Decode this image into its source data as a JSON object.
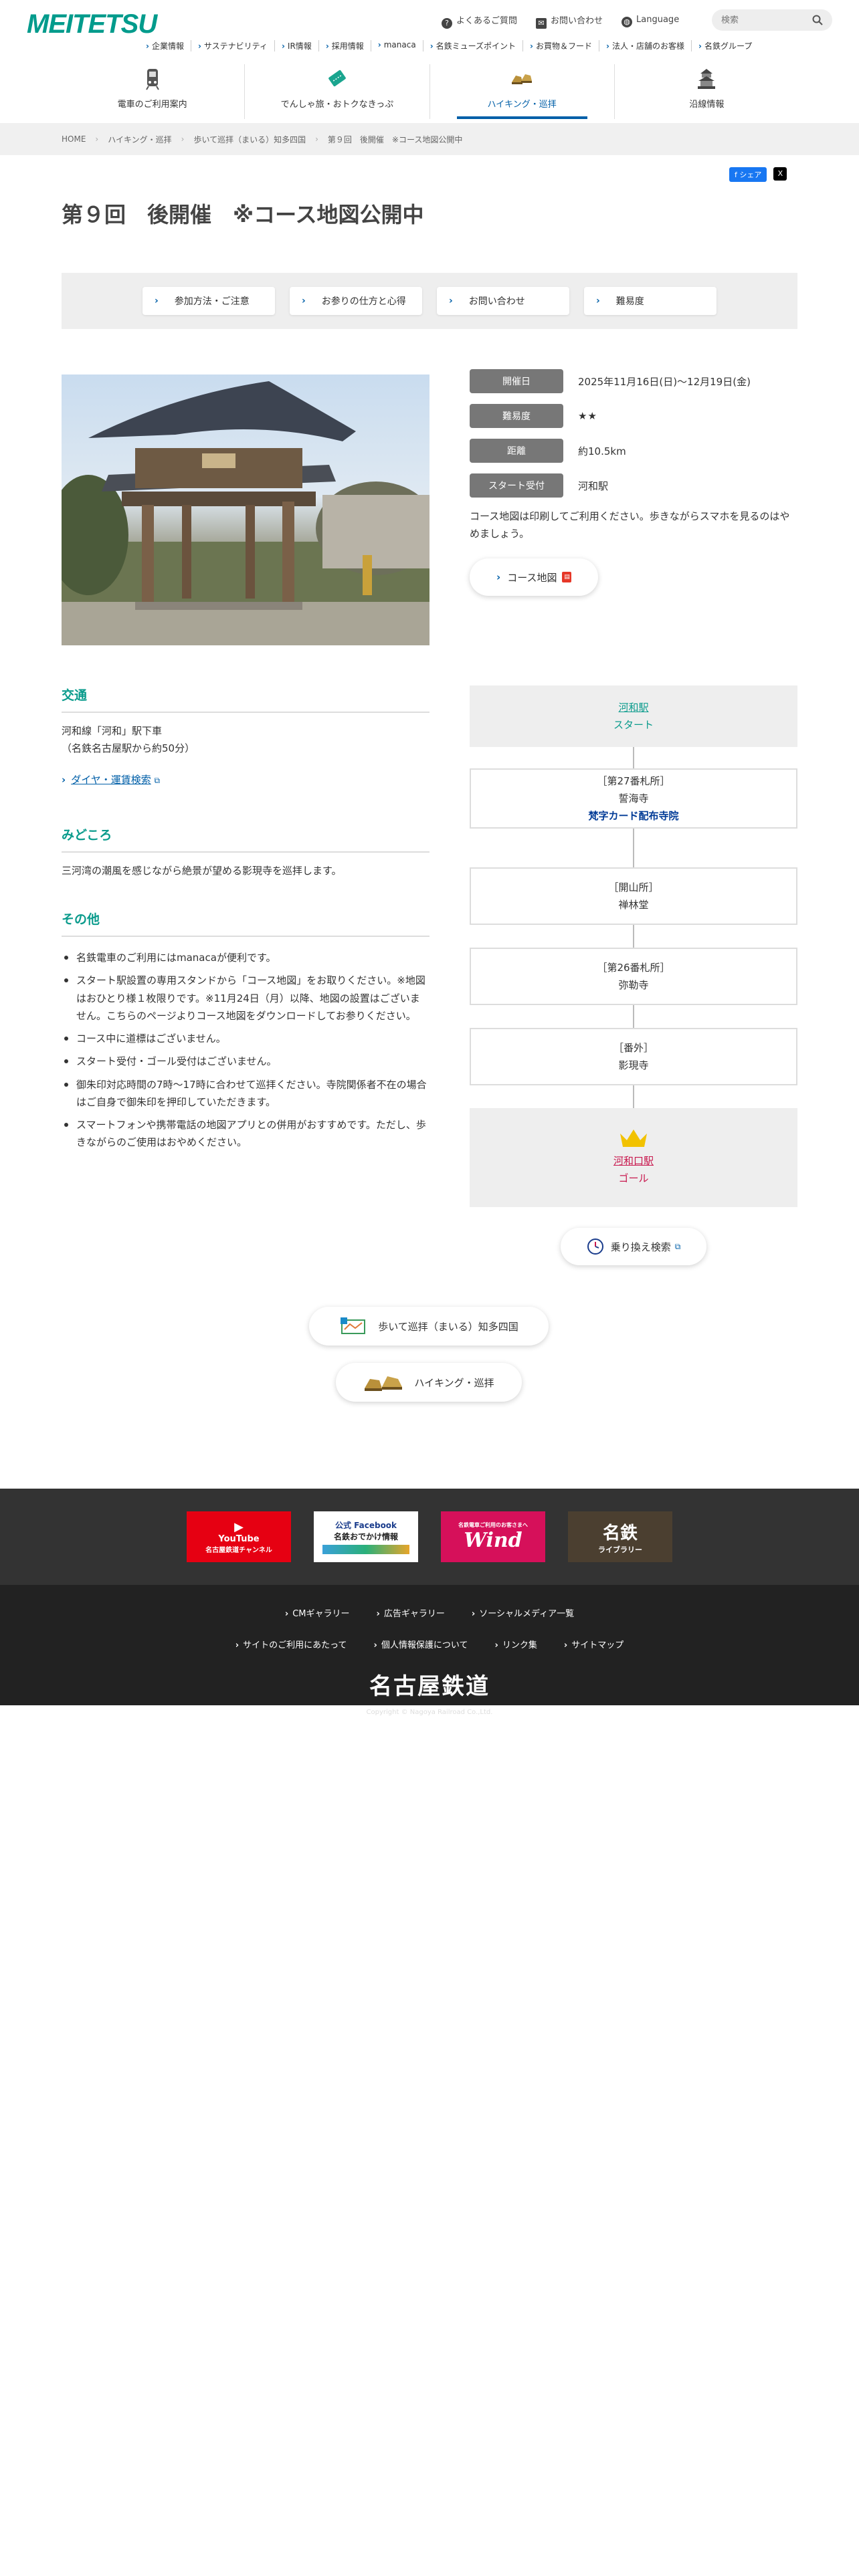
{
  "header": {
    "logo_text": "MEITETSU",
    "util_links": [
      "よくあるご質問",
      "お問い合わせ",
      "Language"
    ],
    "search_placeholder": "検索",
    "sub_links": [
      "企業情報",
      "サステナビリティ",
      "IR情報",
      "採用情報",
      "manaca",
      "名鉄ミューズポイント",
      "お買物＆フード",
      "法人・店舗のお客様",
      "名鉄グループ"
    ],
    "gnav": [
      {
        "label": "電車のご利用案内",
        "icon": "train-icon"
      },
      {
        "label": "でんしゃ旅・おトクなきっぷ",
        "icon": "ticket-icon"
      },
      {
        "label": "ハイキング・巡拝",
        "icon": "hiking-shoes-icon"
      },
      {
        "label": "沿線情報",
        "icon": "castle-icon"
      }
    ]
  },
  "breadcrumb": [
    "HOME",
    "ハイキング・巡拝",
    "歩いて巡拝（まいる）知多四国",
    "第９回　後開催　※コース地図公開中"
  ],
  "share": {
    "facebook": "シェア",
    "x": "X"
  },
  "title": "第９回　後開催　※コース地図公開中",
  "anchors": [
    "参加方法・ご注意",
    "お参りの仕方と心得",
    "お問い合わせ",
    "難易度"
  ],
  "info": {
    "date_label": "開催日",
    "date_value": "2025年11月16日(日)〜12月19日(金)",
    "difficulty_label": "難易度",
    "difficulty_stars": "★★",
    "distance_label": "距離",
    "distance_value": "約10.5km",
    "start_label": "スタート受付",
    "start_value": "河和駅",
    "note": "コース地図は印刷してご利用ください。歩きながらスマホを見るのはやめましょう。",
    "map_button": "コース地図"
  },
  "access": {
    "heading": "交通",
    "text1": "河和線「河和」駅下車",
    "text2": "（名鉄名古屋駅から約50分）",
    "link": "ダイヤ・運賃検索"
  },
  "highlight": {
    "heading": "みどころ",
    "text": "三河湾の潮風を感じながら絶景が望める影現寺を巡拝します。"
  },
  "other": {
    "heading": "その他",
    "items": [
      "名鉄電車のご利用にはmanacaが便利です。",
      "スタート駅設置の専用スタンドから「コース地図」をお取りください。※地図はおひとり様１枚限りです。※11月24日（月）以降、地図の設置はございません。こちらのページよりコース地図をダウンロードしてお参りください。",
      "コース中に道標はございません。",
      "スタート受付・ゴール受付はございません。",
      "御朱印対応時間の7時〜17時に合わせて巡拝ください。寺院関係者不在の場合はご自身で御朱印を押印していただきます。",
      "スマートフォンや携帯電話の地図アプリとの併用がおすすめです。ただし、歩きながらのご使用はおやめください。"
    ]
  },
  "route": {
    "start_station": "河和駅",
    "start_label": "スタート",
    "stops": [
      {
        "label": "［第27番札所］",
        "name": "誓海寺",
        "extra": "梵字カード配布寺院"
      },
      {
        "label": "［開山所］",
        "name": "禅林堂",
        "extra": ""
      },
      {
        "label": "［第26番札所］",
        "name": "弥勒寺",
        "extra": ""
      },
      {
        "label": "［番外］",
        "name": "影現寺",
        "extra": ""
      }
    ],
    "goal_station": "河和口駅",
    "goal_label": "ゴール",
    "transfer_button": "乗り換え検索"
  },
  "bottom_buttons": [
    "歩いて巡拝（まいる）知多四国",
    "ハイキング・巡拝"
  ],
  "footer": {
    "banners": [
      {
        "title": "YouTube",
        "sub": "名古屋鉄道チャンネル",
        "color": "#e60012"
      },
      {
        "title": "公式 Facebook",
        "sub": "名鉄おでかけ情報",
        "color": "#ffffff"
      },
      {
        "title": "Wind",
        "sub": "名鉄電車ご利用のお客さまへ",
        "color": "#d6105a"
      },
      {
        "title": "名鉄",
        "sub": "ライブラリー",
        "color": "#4b3f30"
      }
    ],
    "links_row1": [
      "CMギャラリー",
      "広告ギャラリー",
      "ソーシャルメディア一覧"
    ],
    "links_row2": [
      "サイトのご利用にあたって",
      "個人情報保護について",
      "リンク集",
      "サイトマップ"
    ],
    "logo": "名古屋鉄道",
    "copyright": "Copyright © Nagoya Railroad Co.,Ltd."
  }
}
